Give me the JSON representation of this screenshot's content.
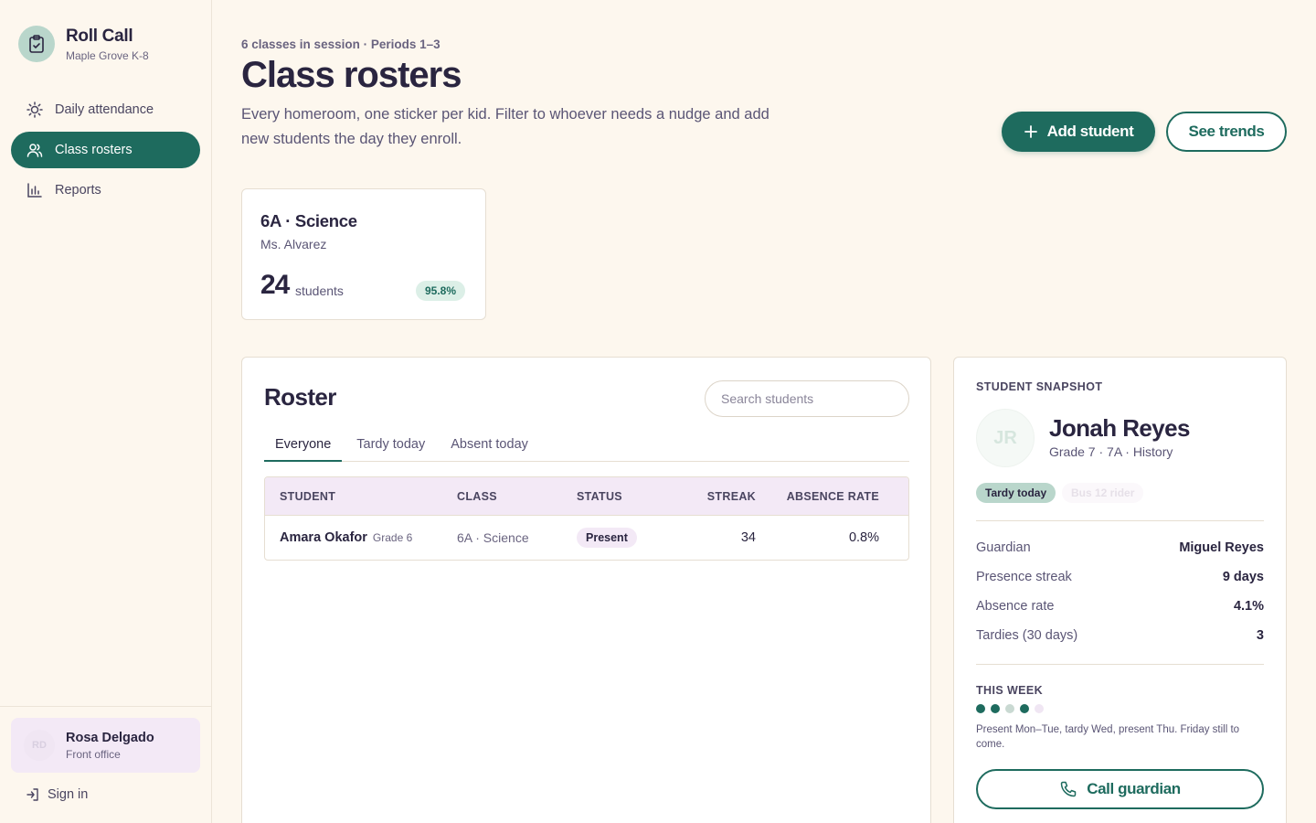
{
  "app": {
    "name": "Roll Call",
    "school": "Maple Grove K-8"
  },
  "sidebar": {
    "items": [
      {
        "label": "Daily attendance",
        "icon": "sun-icon"
      },
      {
        "label": "Class rosters",
        "icon": "users-icon",
        "active": true
      },
      {
        "label": "Reports",
        "icon": "bar-chart-icon"
      }
    ],
    "user": {
      "initials": "RD",
      "name": "Rosa Delgado",
      "role": "Front office"
    },
    "signin_label": "Sign in"
  },
  "header": {
    "eyebrow": "6 classes in session · Periods 1–3",
    "title": "Class rosters",
    "description": "Every homeroom, one sticker per kid. Filter to whoever needs a nudge and add new students the day they enroll.",
    "add_button": "Add student",
    "trends_button": "See trends"
  },
  "class_card": {
    "name": "6A · Science",
    "teacher": "Ms. Alvarez",
    "count": "24",
    "count_unit": "students",
    "attendance": "95.8%"
  },
  "roster": {
    "title": "Roster",
    "search_placeholder": "Search students",
    "tabs": [
      "Everyone",
      "Tardy today",
      "Absent today"
    ],
    "columns": [
      "STUDENT",
      "CLASS",
      "STATUS",
      "STREAK",
      "ABSENCE RATE"
    ],
    "rows": [
      {
        "name": "Amara Okafor",
        "grade": "Grade 6",
        "class": "6A · Science",
        "status": "Present",
        "streak": "34",
        "absence_rate": "0.8%"
      }
    ]
  },
  "snapshot": {
    "eyebrow": "STUDENT SNAPSHOT",
    "initials": "JR",
    "name": "Jonah Reyes",
    "meta": "Grade 7 · 7A · History",
    "chips": [
      "Tardy today",
      "Bus 12 rider"
    ],
    "details": [
      {
        "label": "Guardian",
        "value": "Miguel Reyes"
      },
      {
        "label": "Presence streak",
        "value": "9 days"
      },
      {
        "label": "Absence rate",
        "value": "4.1%"
      },
      {
        "label": "Tardies (30 days)",
        "value": "3"
      }
    ],
    "week_label": "THIS WEEK",
    "week": [
      {
        "day": "Mon",
        "status": "present"
      },
      {
        "day": "Tue",
        "status": "present"
      },
      {
        "day": "Wed",
        "status": "tardy"
      },
      {
        "day": "Thu",
        "status": "present"
      },
      {
        "day": "Fri",
        "status": "upcoming"
      }
    ],
    "week_note": "Present Mon–Tue, tardy Wed, present Thu. Friday still to come.",
    "call_button": "Call guardian"
  },
  "colors": {
    "accent": "#1e6b5e",
    "present": "#1e6b5e",
    "tardy": "#c9d9d2",
    "upcoming": "#f0e6f3",
    "background": "#fdf7ee"
  }
}
